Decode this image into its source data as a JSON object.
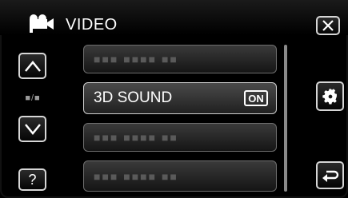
{
  "header": {
    "title": "VIDEO",
    "mode_icon": "video-camera-icon"
  },
  "buttons": {
    "close_icon": "close-icon",
    "up_icon": "chevron-up-icon",
    "down_icon": "chevron-down-icon",
    "help_label": "?",
    "gear_icon": "gear-icon",
    "back_icon": "back-arrow-icon"
  },
  "page_indicator": "■/■",
  "menu": {
    "items": [
      {
        "label": "■■■ ■■■■ ■■",
        "active": false
      },
      {
        "label": "3D SOUND",
        "value": "ON",
        "active": true
      },
      {
        "label": "■■■ ■■■■ ■■",
        "active": false
      },
      {
        "label": "■■■ ■■■■ ■■",
        "active": false
      }
    ]
  },
  "colors": {
    "background": "#000000",
    "button_border": "#d6d6d6",
    "text": "#ffffff"
  }
}
